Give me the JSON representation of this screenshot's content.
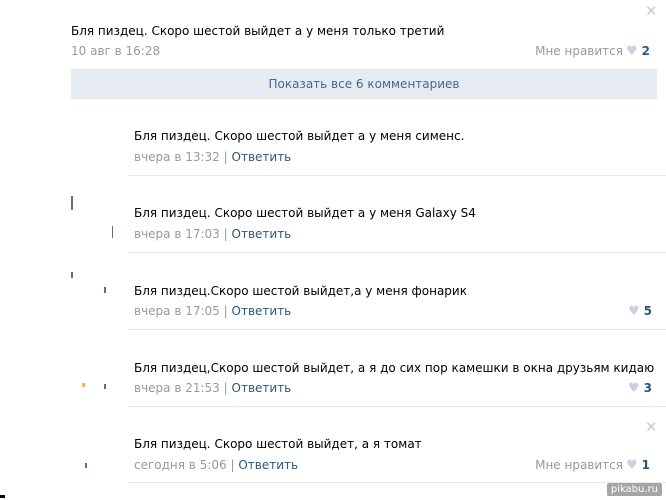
{
  "post": {
    "text": "Бля пиздец. Скоро шестой выйдет а у меня только третий",
    "date": "10 авг в 16:28",
    "like_label": "Мне нравится",
    "like_count": "2"
  },
  "show_all_label": "Показать все 6 комментариев",
  "comments": [
    {
      "text": "Бля пиздец. Скоро шестой выйдет а у меня сименс.",
      "date": "вчера в 13:32",
      "reply": "Ответить",
      "likes": ""
    },
    {
      "text": "Бля пиздец. Скоро шестой выйдет а у меня Galaxy S4",
      "date": "вчера в 17:03",
      "reply": "Ответить",
      "likes": ""
    },
    {
      "text": "Бля пиздец.Скоро шестой выйдет,а у меня фонарик",
      "date": "вчера в 17:05",
      "reply": "Ответить",
      "likes": "5"
    },
    {
      "text": "Бля пиздец,Скоро шестой выйдет, а я до сих пор камешки в окна друзьям кидаю",
      "date": "вчера в 21:53",
      "reply": "Ответить",
      "likes": "3"
    },
    {
      "text": "Бля пиздец. Скоро шестой выйдет, а я томат",
      "date": "сегодня в 5:06",
      "reply": "Ответить",
      "like_label": "Мне нравится",
      "likes": "1"
    }
  ],
  "separator": "|",
  "icons": {
    "close": "close-icon",
    "heart": "heart-icon"
  },
  "watermark": "pikabu.ru"
}
